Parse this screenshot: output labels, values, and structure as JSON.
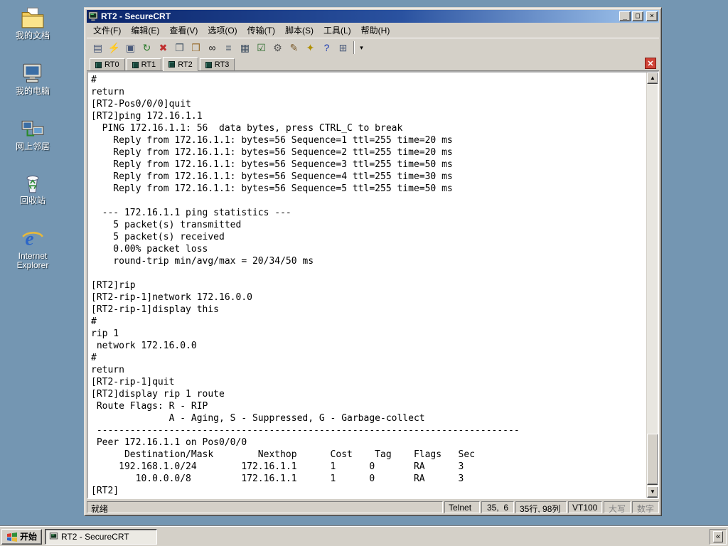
{
  "desktop": {
    "icons": [
      {
        "name": "my-documents",
        "label": "我的文档"
      },
      {
        "name": "my-computer",
        "label": "我的电脑"
      },
      {
        "name": "network-places",
        "label": "网上邻居"
      },
      {
        "name": "recycle-bin",
        "label": "回收站"
      },
      {
        "name": "internet-explorer",
        "label": "Internet Explorer"
      }
    ]
  },
  "window": {
    "title": "RT2 - SecureCRT",
    "controls": {
      "minimize": "_",
      "maximize": "□",
      "close": "×"
    },
    "menu_items": [
      "文件(F)",
      "编辑(E)",
      "查看(V)",
      "选项(O)",
      "传输(T)",
      "脚本(S)",
      "工具(L)",
      "帮助(H)"
    ],
    "toolbar": {
      "buttons": [
        {
          "name": "connect",
          "glyph": "▤",
          "color": "#4a5a7a"
        },
        {
          "name": "quick-connect",
          "glyph": "⚡",
          "color": "#c89000"
        },
        {
          "name": "connect-in-tab",
          "glyph": "▣",
          "color": "#4a5a7a"
        },
        {
          "name": "reconnect",
          "glyph": "↻",
          "color": "#2a7a2a"
        },
        {
          "name": "disconnect",
          "glyph": "✖",
          "color": "#c03030"
        },
        {
          "name": "copy",
          "glyph": "❐",
          "color": "#445566"
        },
        {
          "name": "paste",
          "glyph": "❒",
          "color": "#996f33"
        },
        {
          "name": "find",
          "glyph": "∞",
          "color": "#222222"
        },
        {
          "name": "print",
          "glyph": "≡",
          "color": "#445566"
        },
        {
          "name": "print-preview",
          "glyph": "▦",
          "color": "#445566"
        },
        {
          "name": "session-options",
          "glyph": "☑",
          "color": "#2a6a2a"
        },
        {
          "name": "global-options",
          "glyph": "⚙",
          "color": "#555555"
        },
        {
          "name": "script",
          "glyph": "✎",
          "color": "#7a5a2a"
        },
        {
          "name": "keymap",
          "glyph": "✦",
          "color": "#b09000"
        },
        {
          "name": "help",
          "glyph": "?",
          "color": "#1a3ab0"
        },
        {
          "name": "tile-windows",
          "glyph": "⊞",
          "color": "#4a5a7a"
        }
      ],
      "overflow_glyph": "▾"
    },
    "tabs": [
      {
        "label": "RT0",
        "active": false
      },
      {
        "label": "RT1",
        "active": false
      },
      {
        "label": "RT2",
        "active": true
      },
      {
        "label": "RT3",
        "active": false
      }
    ],
    "tab_close_glyph": "✕",
    "terminal": {
      "lines": [
        "#",
        "return",
        "[RT2-Pos0/0/0]quit",
        "[RT2]ping 172.16.1.1",
        "  PING 172.16.1.1: 56  data bytes, press CTRL_C to break",
        "    Reply from 172.16.1.1: bytes=56 Sequence=1 ttl=255 time=20 ms",
        "    Reply from 172.16.1.1: bytes=56 Sequence=2 ttl=255 time=20 ms",
        "    Reply from 172.16.1.1: bytes=56 Sequence=3 ttl=255 time=50 ms",
        "    Reply from 172.16.1.1: bytes=56 Sequence=4 ttl=255 time=30 ms",
        "    Reply from 172.16.1.1: bytes=56 Sequence=5 ttl=255 time=50 ms",
        "",
        "  --- 172.16.1.1 ping statistics ---",
        "    5 packet(s) transmitted",
        "    5 packet(s) received",
        "    0.00% packet loss",
        "    round-trip min/avg/max = 20/34/50 ms",
        "",
        "[RT2]rip",
        "[RT2-rip-1]network 172.16.0.0",
        "[RT2-rip-1]display this",
        "#",
        "rip 1",
        " network 172.16.0.0",
        "#",
        "return",
        "[RT2-rip-1]quit",
        "[RT2]display rip 1 route",
        " Route Flags: R - RIP",
        "              A - Aging, S - Suppressed, G - Garbage-collect",
        " ----------------------------------------------------------------------------",
        " Peer 172.16.1.1 on Pos0/0/0",
        "      Destination/Mask        Nexthop      Cost    Tag    Flags   Sec",
        "     192.168.1.0/24        172.16.1.1      1      0       RA      3",
        "        10.0.0.0/8         172.16.1.1      1      0       RA      3",
        "[RT2]"
      ]
    },
    "status": {
      "ready": "就绪",
      "protocol": "Telnet",
      "cursor": "35,  6",
      "dimensions": "35行, 98列",
      "emulation": "VT100",
      "caps_lock": "大写",
      "num_lock": "数字"
    }
  },
  "taskbar": {
    "start_label": "开始",
    "task_label": "RT2 - SecureCRT",
    "tray_collapse": "«"
  }
}
